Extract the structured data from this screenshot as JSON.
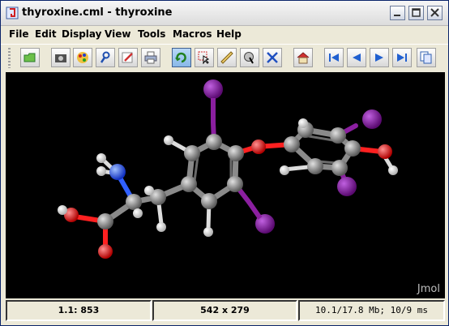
{
  "window": {
    "title": "thyroxine.cml - thyroxine"
  },
  "menu": [
    "File",
    "Edit",
    "Display",
    "View",
    "Tools",
    "Macros",
    "Help"
  ],
  "toolbar": {
    "buttons": [
      "open-folder-icon",
      "camera-icon",
      "palette-icon",
      "wrench-icon",
      "pencil-icon",
      "print-icon",
      "rotate-icon",
      "select-icon",
      "ruler-icon",
      "measure-icon",
      "pick-icon",
      "home-icon",
      "first-frame-icon",
      "prev-frame-icon",
      "next-frame-icon",
      "last-frame-icon",
      "copy-icon"
    ]
  },
  "viewer": {
    "watermark": "Jmol"
  },
  "status": {
    "atom": "1.1: 853",
    "size": "542 x 279",
    "perf": "10.1/17.8 Mb;  10/9 ms"
  },
  "colors": {
    "carbon": "#8a8a8a",
    "iodine": "#8b1fa0",
    "oxygen": "#ff1010",
    "nitrogen": "#3060ff",
    "hydrogen": "#ffffff",
    "background": "#000000"
  }
}
